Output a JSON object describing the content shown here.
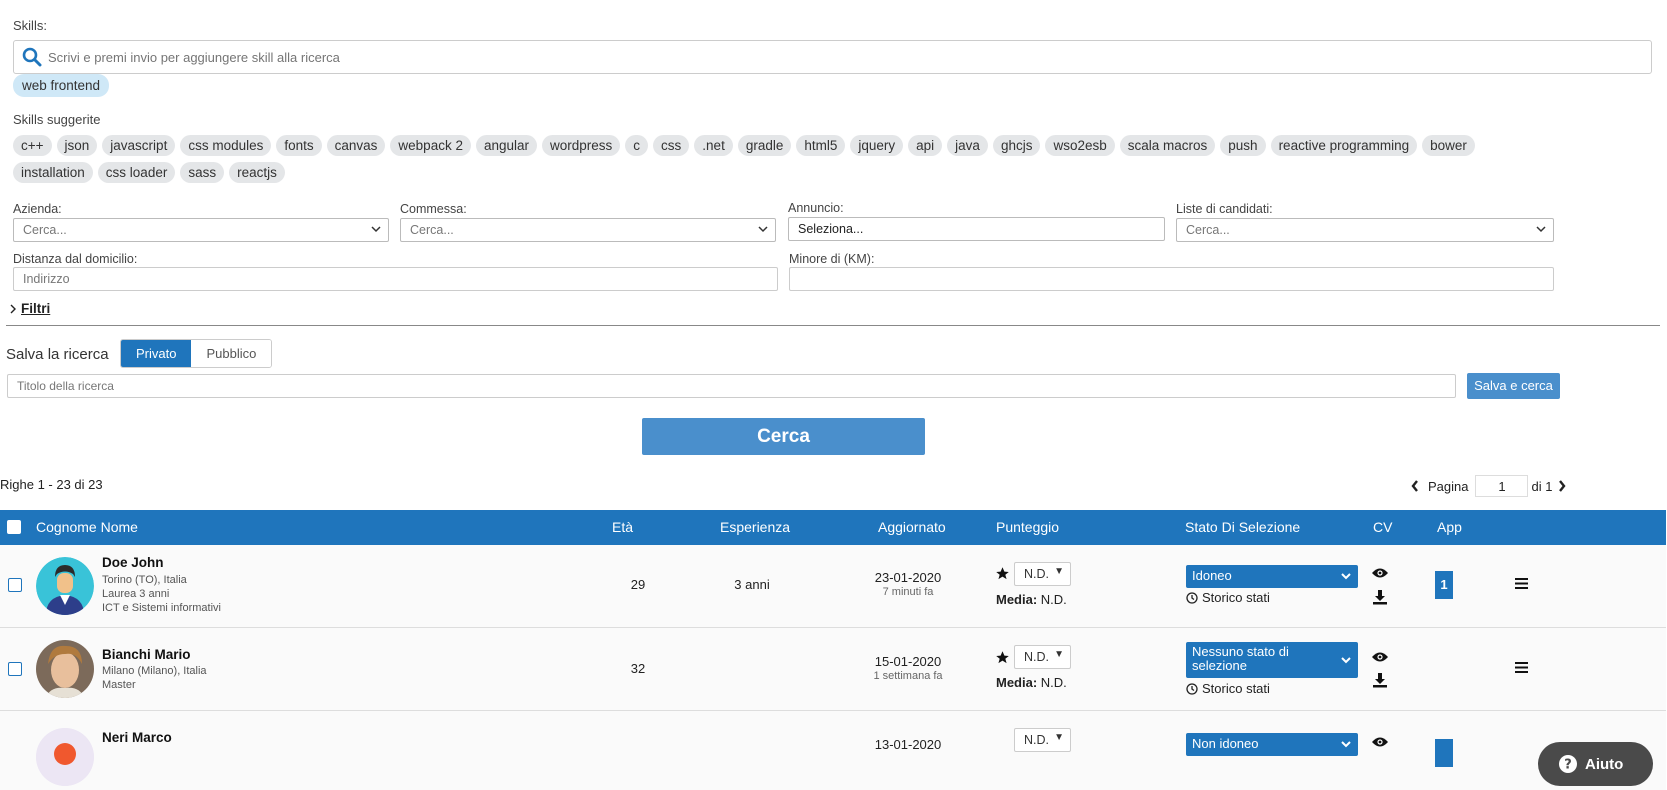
{
  "skills": {
    "label": "Skills:",
    "search_placeholder": "Scrivi e premi invio per aggiungere skill alla ricerca",
    "selected": [
      "web frontend"
    ],
    "suggested_label": "Skills suggerite",
    "suggested": [
      "c++",
      "json",
      "javascript",
      "css modules",
      "fonts",
      "canvas",
      "webpack 2",
      "angular",
      "wordpress",
      "c",
      "css",
      ".net",
      "gradle",
      "html5",
      "jquery",
      "api",
      "java",
      "ghcjs",
      "wso2esb",
      "scala macros",
      "push",
      "reactive programming",
      "bower",
      "installation",
      "css loader",
      "sass",
      "reactjs"
    ]
  },
  "filters": {
    "azienda_label": "Azienda:",
    "azienda_placeholder": "Cerca...",
    "commessa_label": "Commessa:",
    "commessa_placeholder": "Cerca...",
    "annuncio_label": "Annuncio:",
    "annuncio_value": "Seleziona...",
    "liste_label": "Liste di candidati:",
    "liste_placeholder": "Cerca...",
    "distanza_label": "Distanza dal domicilio:",
    "indirizzo_placeholder": "Indirizzo",
    "minore_label": "Minore di (KM):",
    "filtri_link": "Filtri"
  },
  "save": {
    "label": "Salva la ricerca",
    "privato": "Privato",
    "pubblico": "Pubblico",
    "title_placeholder": "Titolo della ricerca",
    "save_button": "Salva e cerca",
    "search_button": "Cerca"
  },
  "results": {
    "count_text": "Righe 1 - 23 di 23",
    "page_label": "Pagina",
    "page_value": "1",
    "page_total": "di 1"
  },
  "table": {
    "headers": {
      "name": "Cognome Nome",
      "age": "Età",
      "experience": "Esperienza",
      "updated": "Aggiornato",
      "score": "Punteggio",
      "status": "Stato Di Selezione",
      "cv": "CV",
      "app": "App"
    },
    "rows": [
      {
        "name": "Doe John",
        "line1": "Torino (TO), Italia",
        "line2": "Laurea 3 anni",
        "line3": "ICT e Sistemi informativi",
        "age": "29",
        "experience": "3 anni",
        "date": "23-01-2020",
        "ago": "7 minuti fa",
        "score": "N.D.",
        "media_label": "Media:",
        "media": "N.D.",
        "status": "Idoneo",
        "history": "Storico stati",
        "app": "1"
      },
      {
        "name": "Bianchi Mario",
        "line1": "Milano (Milano), Italia",
        "line2": "Master",
        "line3": "",
        "age": "32",
        "experience": "",
        "date": "15-01-2020",
        "ago": "1 settimana fa",
        "score": "N.D.",
        "media_label": "Media:",
        "media": "N.D.",
        "status": "Nessuno stato di selezione",
        "history": "Storico stati",
        "app": ""
      },
      {
        "name": "Neri Marco",
        "line1": "",
        "line2": "",
        "line3": "",
        "age": "",
        "experience": "",
        "date": "13-01-2020",
        "ago": "",
        "score": "N.D.",
        "media_label": "",
        "media": "",
        "status": "Non idoneo",
        "history": "",
        "app": ""
      }
    ]
  },
  "help": {
    "label": "Aiuto"
  },
  "colors": {
    "primary": "#1f75bc",
    "button": "#4a8fcc",
    "chip": "#e4e6e8",
    "chip_active": "#cfe8f7"
  }
}
